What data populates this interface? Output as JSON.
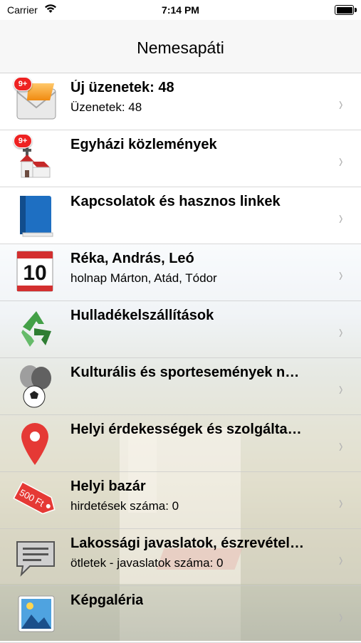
{
  "status": {
    "carrier": "Carrier",
    "time": "7:14 PM"
  },
  "nav": {
    "title": "Nemesapáti"
  },
  "rows": [
    {
      "title": "Új üzenetek: 48",
      "sub": "Üzenetek: 48",
      "badge": "9+",
      "icon": "envelope-icon"
    },
    {
      "title": "Egyházi közlemények",
      "sub": "",
      "badge": "9+",
      "icon": "church-icon"
    },
    {
      "title": "Kapcsolatok és hasznos linkek",
      "sub": "",
      "icon": "book-icon"
    },
    {
      "title": "Réka, András, Leó",
      "sub": "holnap Márton, Atád, Tódor",
      "icon": "calendar-icon",
      "calendar_day": "10"
    },
    {
      "title": "Hulladékelszállítások",
      "sub": "",
      "icon": "recycle-icon"
    },
    {
      "title": "Kulturális és sportesemények n…",
      "sub": "",
      "icon": "masks-football-icon"
    },
    {
      "title": "Helyi érdekességek és szolgálta…",
      "sub": "",
      "icon": "map-pin-icon"
    },
    {
      "title": "Helyi bazár",
      "sub": "hirdetések száma: 0",
      "icon": "price-tag-icon",
      "tag_text": "500 Ft"
    },
    {
      "title": "Lakossági javaslatok, észrevétel…",
      "sub": "ötletek - javaslatok száma: 0",
      "icon": "speech-bubble-icon"
    },
    {
      "title": "Képgaléria",
      "sub": "",
      "icon": "photo-icon"
    }
  ],
  "chevron": "›"
}
